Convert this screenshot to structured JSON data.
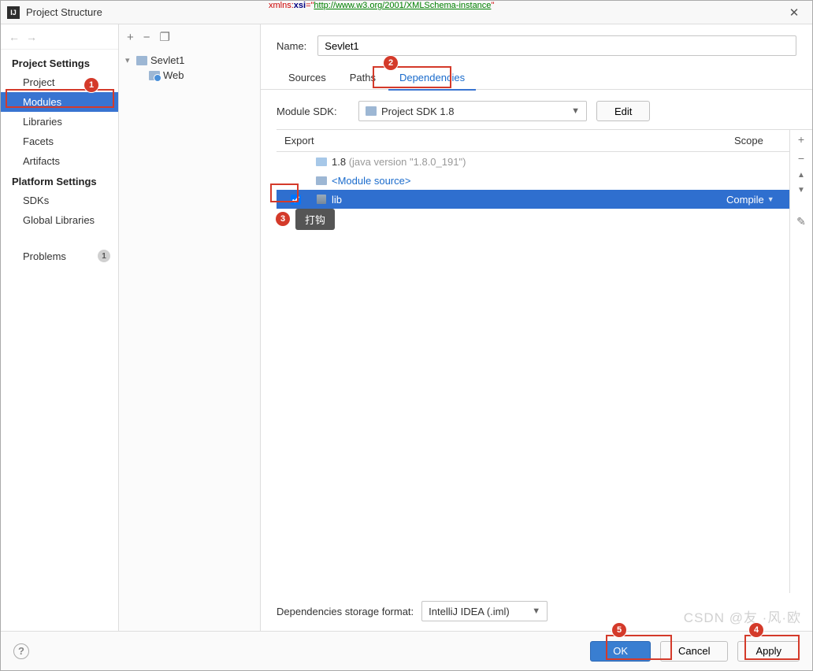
{
  "artifact": {
    "pre": "xmlns:",
    "kw": "xsi",
    "mid": "=\"",
    "url": "http://www.w3.org/2001/XMLSchema-instance",
    "end": "\""
  },
  "window": {
    "title": "Project Structure",
    "close": "✕"
  },
  "nav": {
    "back": "←",
    "forward": "→"
  },
  "sidebar": {
    "section1": "Project Settings",
    "items1": [
      "Project",
      "Modules",
      "Libraries",
      "Facets",
      "Artifacts"
    ],
    "section2": "Platform Settings",
    "items2": [
      "SDKs",
      "Global Libraries"
    ],
    "problems": "Problems",
    "problems_count": "1"
  },
  "treeToolbar": {
    "add": "+",
    "remove": "−",
    "copy": "❐"
  },
  "tree": {
    "root": "Sevlet1",
    "child": "Web"
  },
  "name": {
    "label": "Name:",
    "value": "Sevlet1"
  },
  "tabs": [
    "Sources",
    "Paths",
    "Dependencies"
  ],
  "sdk": {
    "label": "Module SDK:",
    "value": "Project SDK 1.8",
    "edit": "Edit"
  },
  "depsHead": {
    "export": "Export",
    "scope": "Scope"
  },
  "deps": {
    "r0": {
      "name": "1.8",
      "suffix": "(java version \"1.8.0_191\")"
    },
    "r1": {
      "name": "<Module source>"
    },
    "r2": {
      "name": "lib",
      "scope": "Compile"
    }
  },
  "tools": {
    "add": "+",
    "remove": "−",
    "up": "▲",
    "down": "▼",
    "edit": "✎"
  },
  "storage": {
    "label": "Dependencies storage format:",
    "value": "IntelliJ IDEA (.iml)"
  },
  "footer": {
    "help": "?",
    "ok": "OK",
    "cancel": "Cancel",
    "apply": "Apply"
  },
  "annot": {
    "m1": "1",
    "m2": "2",
    "m3": "3",
    "m4": "4",
    "m5": "5",
    "tip": "打钩"
  },
  "watermark": "CSDN @友 ·风·欧"
}
